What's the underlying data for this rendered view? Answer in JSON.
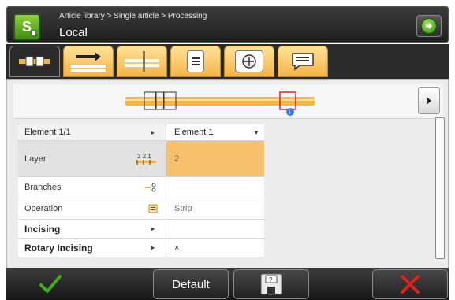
{
  "header": {
    "breadcrumb": "Article library > Single article > Processing",
    "title": "Local"
  },
  "tabs": [
    {
      "name": "element-view",
      "active": true
    },
    {
      "name": "feed",
      "active": false
    },
    {
      "name": "cut",
      "active": false
    },
    {
      "name": "list",
      "active": false
    },
    {
      "name": "target",
      "active": false
    },
    {
      "name": "comment",
      "active": false
    }
  ],
  "table": {
    "header": {
      "label": "Element 1/1",
      "value": "Element 1"
    },
    "rows": [
      {
        "label": "Layer",
        "value": "2",
        "icon": "layer-icon",
        "selected": true
      },
      {
        "label": "Branches",
        "value": "",
        "icon": "branches-icon"
      },
      {
        "label": "Operation",
        "value": "Strip",
        "icon": "operation-icon"
      },
      {
        "label": "Incising",
        "value": "",
        "icon": "chevron-right-icon",
        "bold": true
      },
      {
        "label": "Rotary Incising",
        "value": "×",
        "icon": "chevron-right-icon",
        "bold": true
      }
    ]
  },
  "footer": {
    "default_label": "Default"
  },
  "colors": {
    "accent": "#f4b446",
    "confirm": "#3faa1e",
    "cancel": "#e0201c",
    "header_bg": "#2a2a2a"
  }
}
